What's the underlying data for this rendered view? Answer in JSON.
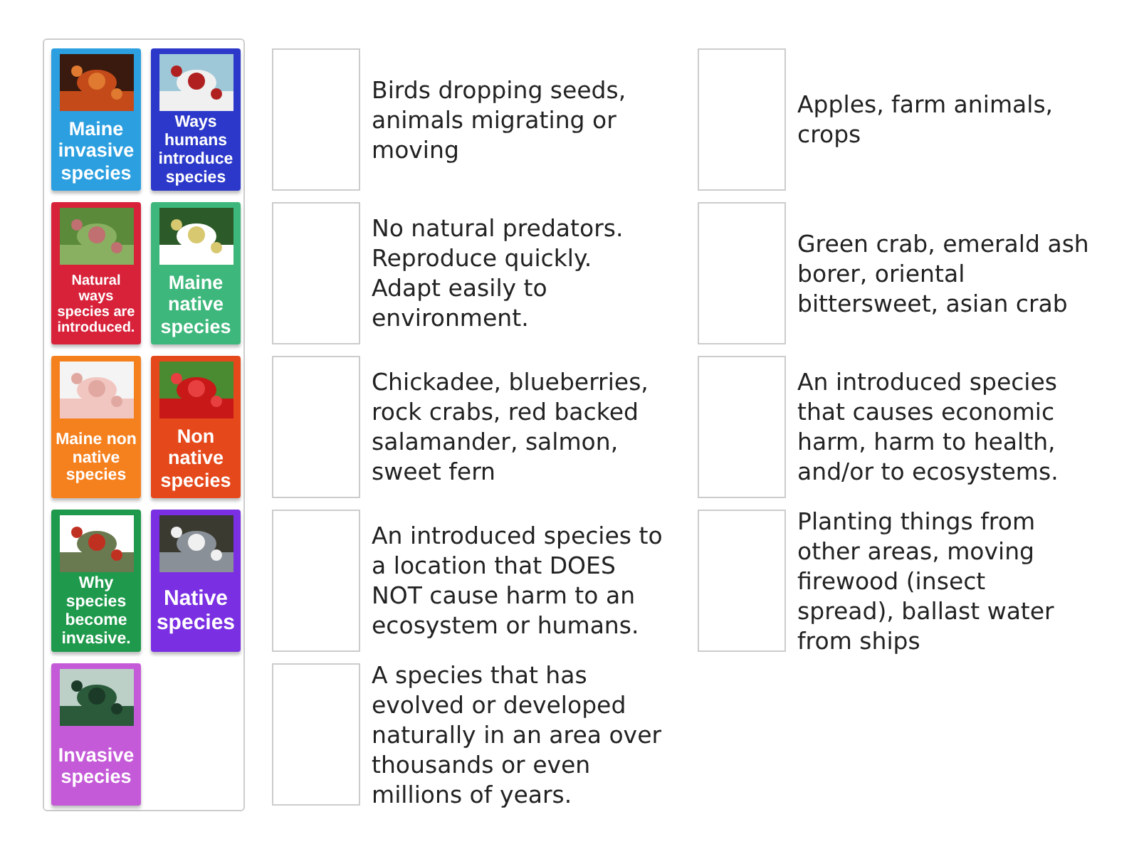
{
  "tiles": [
    {
      "label": "Maine invasive species",
      "color": "#2b9fe0"
    },
    {
      "label": "Ways humans introduce species",
      "color": "#2b38c9"
    },
    {
      "label": "Natural ways species are introduced.",
      "color": "#d7223a"
    },
    {
      "label": "Maine native species",
      "color": "#3db77b"
    },
    {
      "label": "Maine non native species",
      "color": "#f5801e"
    },
    {
      "label": "Non native species",
      "color": "#e5481a"
    },
    {
      "label": "Why species become invasive.",
      "color": "#1f9a4c"
    },
    {
      "label": "Native species",
      "color": "#7a2fe2"
    },
    {
      "label": "Invasive species",
      "color": "#c55ad8"
    }
  ],
  "targets_left": [
    "Birds dropping seeds, animals migrating or moving",
    "No natural predators. Reproduce quickly. Adapt easily to environment.",
    "Chickadee, blueberries, rock crabs, red backed salamander, salmon, sweet fern",
    "An introduced species to a location that DOES NOT cause harm to an ecosystem or humans.",
    "A species that has evolved or developed naturally in an area over thousands or even millions of years."
  ],
  "targets_right": [
    "Apples, farm animals, crops",
    "Green crab, emerald ash borer, oriental bittersweet, asian crab",
    "An introduced species that causes economic harm, harm to health, and/or to ecosystems.",
    "Planting things from other areas, moving firewood (insect spread), ballast water from ships"
  ]
}
